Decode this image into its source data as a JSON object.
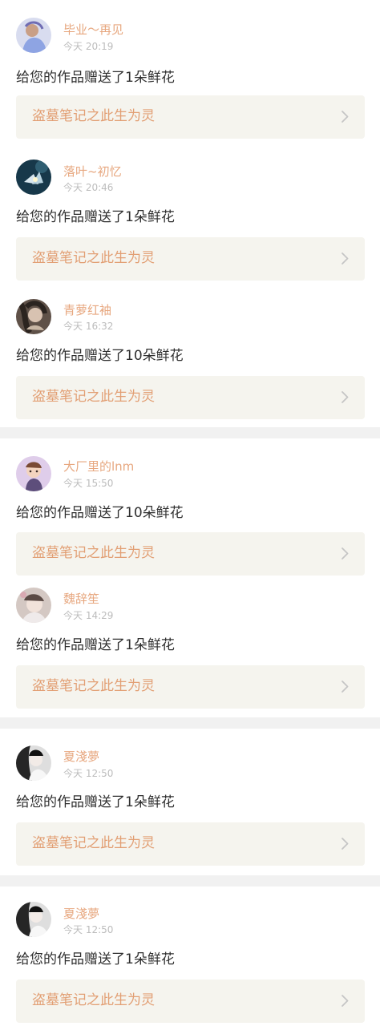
{
  "notifications": [
    {
      "user_name": "毕业～再见",
      "time": "今天 20:19",
      "message": "给您的作品赠送了1朵鲜花",
      "work_title": "盗墓笔记之此生为灵",
      "avatar_icon": "user-avatar-icon"
    },
    {
      "user_name": "落叶~初忆",
      "time": "今天 20:46",
      "message": "给您的作品赠送了1朵鲜花",
      "work_title": "盗墓笔记之此生为灵",
      "avatar_icon": "user-avatar-icon"
    },
    {
      "user_name": "青萝红袖",
      "time": "今天 16:32",
      "message": "给您的作品赠送了10朵鲜花",
      "work_title": "盗墓笔记之此生为灵",
      "avatar_icon": "user-avatar-icon"
    },
    {
      "user_name": "大厂里的lnm",
      "time": "今天 15:50",
      "message": "给您的作品赠送了10朵鲜花",
      "work_title": "盗墓笔记之此生为灵",
      "avatar_icon": "user-avatar-icon"
    },
    {
      "user_name": "魏辞笙",
      "time": "今天 14:29",
      "message": "给您的作品赠送了1朵鲜花",
      "work_title": "盗墓笔记之此生为灵",
      "avatar_icon": "user-avatar-icon"
    },
    {
      "user_name": "夏淺夢",
      "time": "今天 12:50",
      "message": "给您的作品赠送了1朵鲜花",
      "work_title": "盗墓笔记之此生为灵",
      "avatar_icon": "user-avatar-icon"
    },
    {
      "user_name": "夏淺夢",
      "time": "今天 12:50",
      "message": "给您的作品赠送了1朵鲜花",
      "work_title": "盗墓笔记之此生为灵",
      "avatar_icon": "user-avatar-icon"
    }
  ],
  "icons": {
    "chevron": "chevron-right-icon"
  },
  "colors": {
    "username": "#e7a77f",
    "timestamp": "#bcbcbc",
    "message": "#2f2f2f",
    "work_title": "#e29f74",
    "work_card_bg": "#f5f4ee",
    "separator": "#f1f1f1"
  }
}
